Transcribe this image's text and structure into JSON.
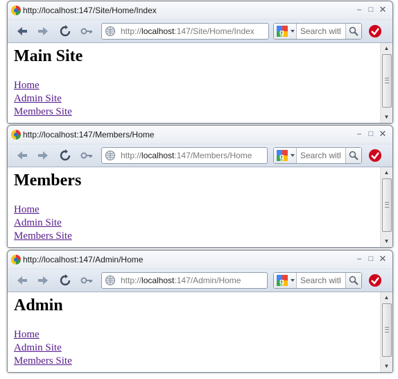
{
  "windows": [
    {
      "title": "http://localhost:147/Site/Home/Index",
      "url": {
        "scheme": "http://",
        "host": "localhost",
        "path": ":147/Site/Home/Index"
      },
      "search": {
        "placeholder": "Search with"
      },
      "heading": "Main Site",
      "links": [
        "Home",
        "Admin Site",
        "Members Site"
      ]
    },
    {
      "title": "http://localhost:147/Members/Home",
      "url": {
        "scheme": "http://",
        "host": "localhost",
        "path": ":147/Members/Home"
      },
      "search": {
        "placeholder": "Search with"
      },
      "heading": "Members",
      "links": [
        "Home",
        "Admin Site",
        "Members Site"
      ]
    },
    {
      "title": "http://localhost:147/Admin/Home",
      "url": {
        "scheme": "http://",
        "host": "localhost",
        "path": ":147/Admin/Home"
      },
      "search": {
        "placeholder": "Search with"
      },
      "heading": "Admin",
      "links": [
        "Home",
        "Admin Site",
        "Members Site"
      ]
    }
  ],
  "icons": {
    "window_controls": [
      "minimize-icon",
      "maximize-icon",
      "close-icon"
    ],
    "toolbar": [
      "back-arrow-icon",
      "forward-arrow-icon",
      "reload-icon",
      "key-icon",
      "globe-icon",
      "google-logo-icon",
      "dropdown-arrow-icon",
      "search-icon",
      "checkmark-badge-icon"
    ]
  },
  "colors": {
    "visited_link": "#551a8b",
    "toolbar_bg": "#d6dee9",
    "check_badge": "#d0021b"
  }
}
